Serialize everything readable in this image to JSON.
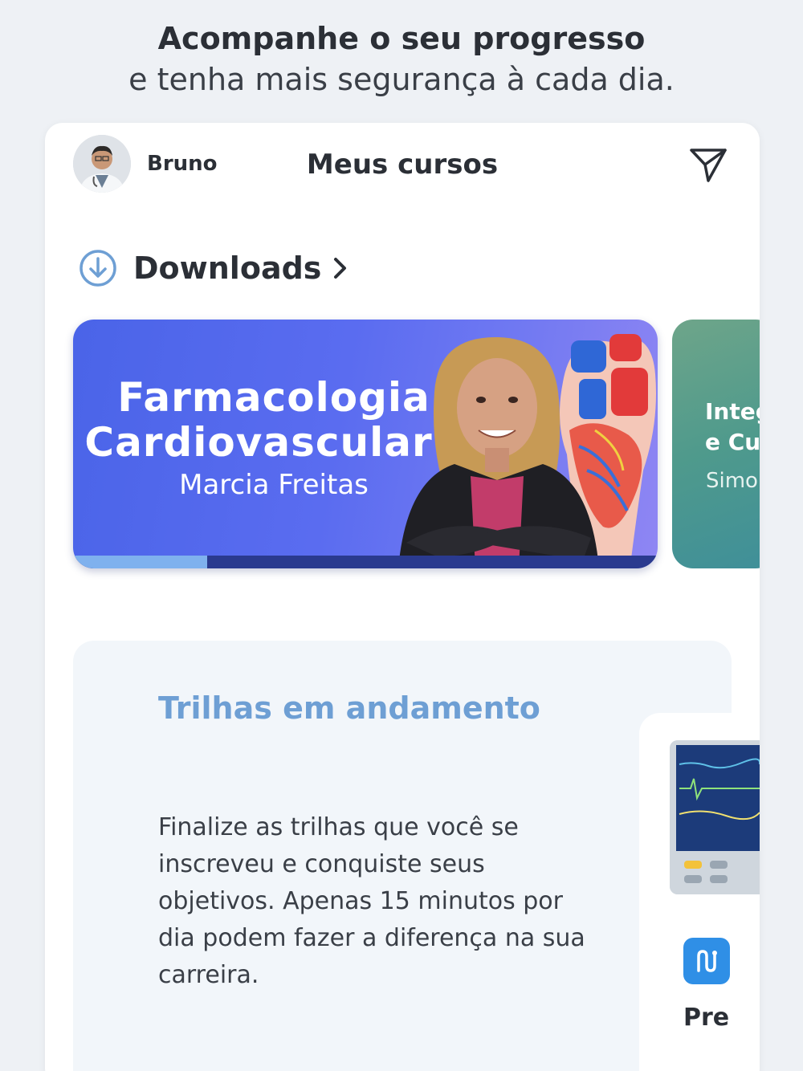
{
  "promo": {
    "headline": "Acompanhe o seu progresso",
    "subheadline": "e tenha mais segurança à cada dia."
  },
  "header": {
    "user_name": "Bruno",
    "title": "Meus cursos",
    "avatar_icon": "doctor-avatar",
    "action_icon": "send-icon"
  },
  "downloads": {
    "label": "Downloads",
    "icon": "download-circle-icon"
  },
  "courses": [
    {
      "title_line1": "Farmacologia",
      "title_line2": "Cardiovascular I",
      "author": "Marcia Freitas",
      "progress": 0.23,
      "color": "#4a64e8"
    },
    {
      "title_line1": "Integ",
      "title_line2": "e Cu",
      "author": "Simon",
      "color": "#4f9a8c"
    }
  ],
  "trails": {
    "title": "Trilhas em andamento",
    "description": "Finalize as trilhas que você se inscreveu e conquiste seus objetivos. Apenas 15 minutos por dia podem fazer a diferença na sua carreira.",
    "card_label": "Pre",
    "title_color": "#6e9fd4",
    "badge_color": "#2f8fe6"
  }
}
